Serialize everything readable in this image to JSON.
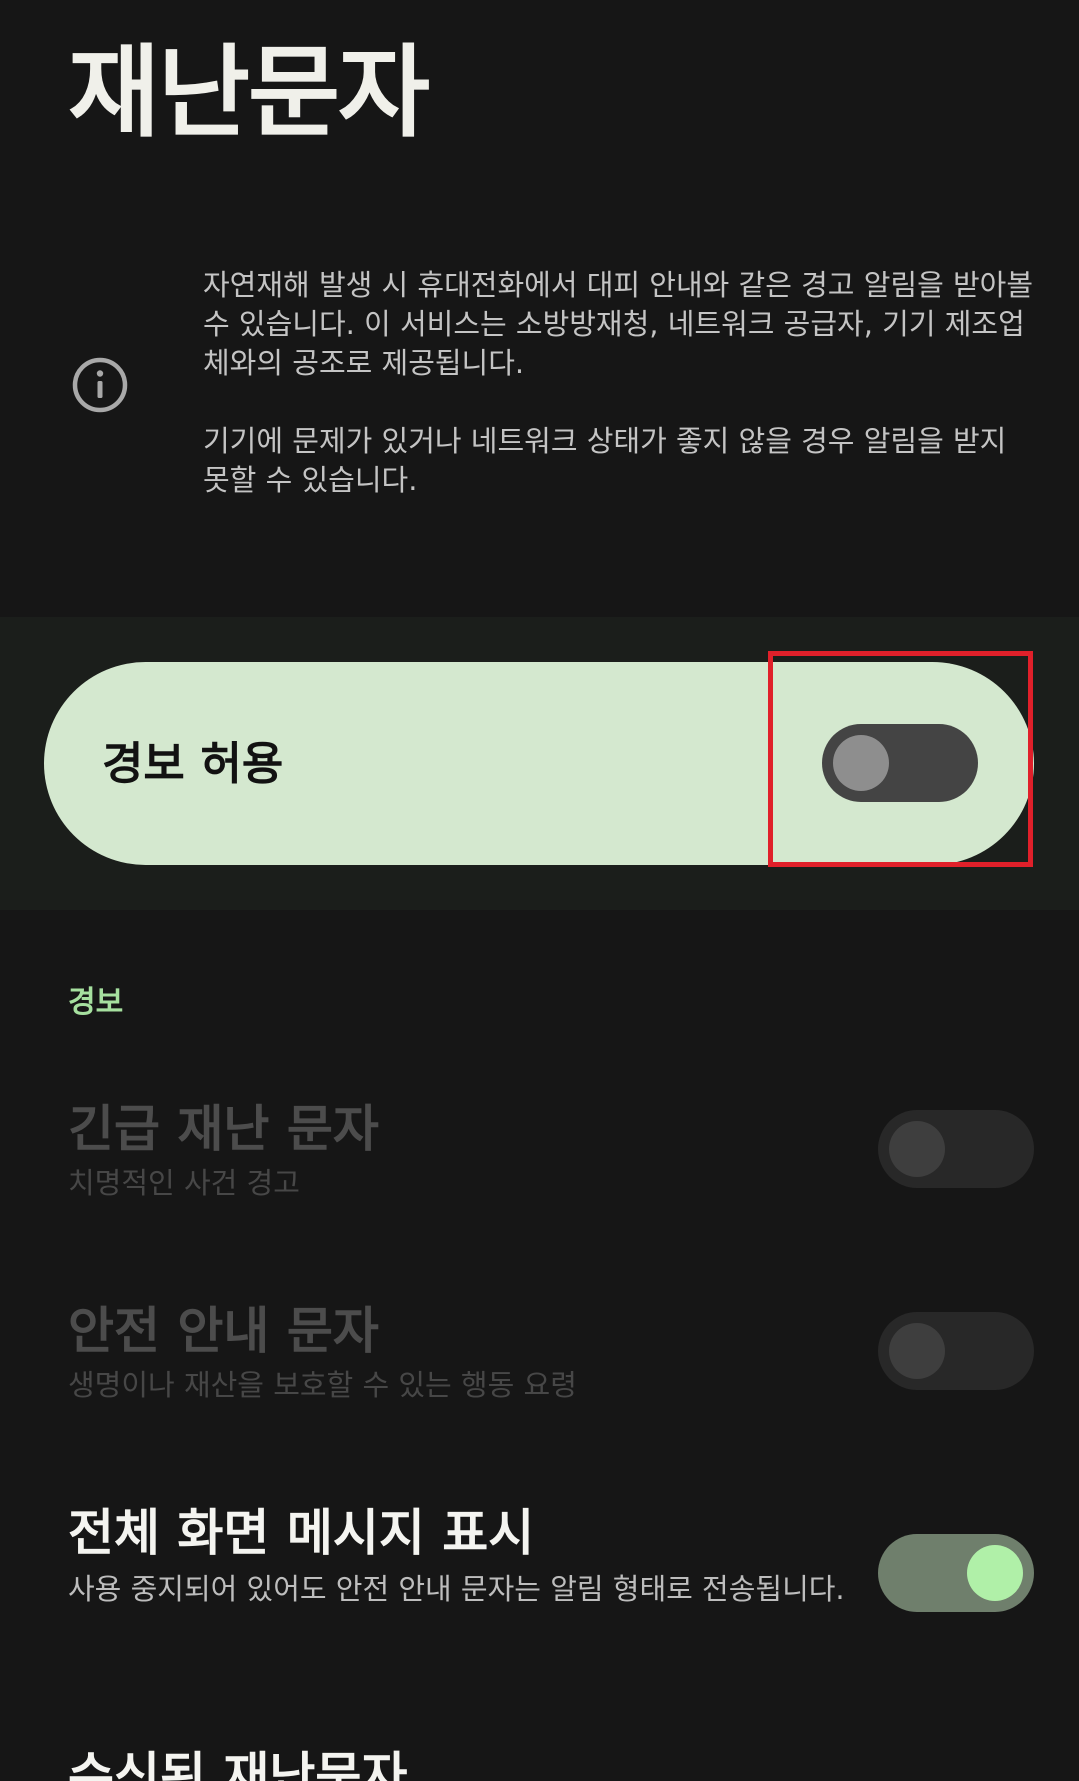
{
  "page": {
    "title": "재난문자"
  },
  "info": {
    "icon": "info-icon",
    "paragraph1": "자연재해 발생 시 휴대전화에서 대피 안내와 같은 경고 알림을 받아볼 수 있습니다. 이 서비스는 소방방재청, 네트워크 공급자, 기기 제조업체와의 공조로 제공됩니다.",
    "paragraph2": "기기에 문제가 있거나 네트워크 상태가 좋지 않을 경우 알림을 받지 못할 수 있습니다."
  },
  "master_toggle": {
    "label": "경보 허용",
    "checked": false
  },
  "alerts_section": {
    "header": "경보",
    "items": [
      {
        "title": "긴급 재난 문자",
        "subtitle": "치명적인 사건 경고",
        "checked": false,
        "enabled": false
      },
      {
        "title": "안전 안내 문자",
        "subtitle": "생명이나 재산을 보호할 수 있는 행동 요령",
        "checked": false,
        "enabled": false
      },
      {
        "title": "전체 화면 메시지 표시",
        "subtitle": "사용 중지되어 있어도 안전 안내 문자는 알림 형태로 전송됩니다.",
        "checked": true,
        "enabled": true
      }
    ]
  },
  "received_section": {
    "title": "수신된 재난문자"
  },
  "colors": {
    "background": "#161616",
    "card": "#d4e8cf",
    "accent": "#a6e09f",
    "highlight": "#e0202a"
  }
}
